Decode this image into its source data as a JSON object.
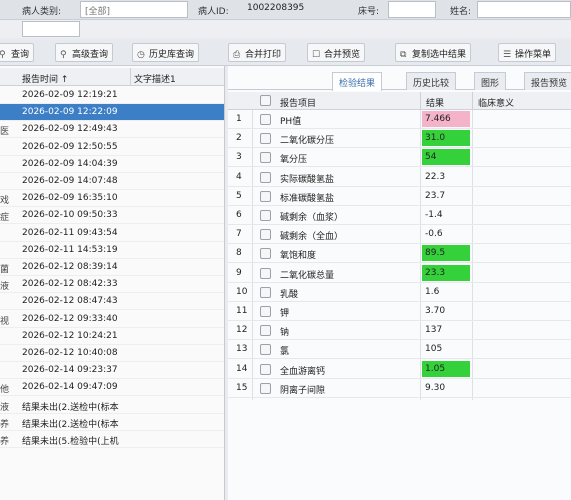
{
  "colors": {
    "selected_row": "#3d7fc6",
    "result_high": "#f4b3c8",
    "result_abnormal": "#35d13a",
    "active_tab_text": "#3a6fb0"
  },
  "topbar": {
    "patient_type_label": "病人类别:",
    "patient_type_value": "[全部]",
    "patient_id_label": "病人ID:",
    "patient_id_value": "1002208395",
    "bed_label": "床号:",
    "name_label": "姓名:"
  },
  "toolbar": {
    "buttons": [
      {
        "label": "查询",
        "icon": "search-icon"
      },
      {
        "label": "高级查询",
        "icon": "search-icon"
      },
      {
        "label": "历史库查询",
        "icon": "history-icon"
      },
      {
        "label": "合并打印",
        "icon": "print-icon"
      },
      {
        "label": "合并预览",
        "icon": "preview-icon"
      },
      {
        "label": "复制选中结果",
        "icon": "copy-icon"
      },
      {
        "label": "操作菜单",
        "icon": "menu-icon"
      }
    ]
  },
  "left_list": {
    "col_time": "报告时间 ↑",
    "col_desc": "文字描述1",
    "rows": [
      {
        "prefix": "",
        "time": "2026-02-09 12:19:21",
        "desc": ""
      },
      {
        "prefix": "",
        "time": "2026-02-09 12:22:09",
        "desc": "",
        "selected": true
      },
      {
        "prefix": "医",
        "time": "2026-02-09 12:49:43",
        "desc": ""
      },
      {
        "prefix": "",
        "time": "2026-02-09 12:50:55",
        "desc": ""
      },
      {
        "prefix": "",
        "time": "2026-02-09 14:04:39",
        "desc": ""
      },
      {
        "prefix": "",
        "time": "2026-02-09 14:07:48",
        "desc": ""
      },
      {
        "prefix": "戏",
        "time": "2026-02-09 16:35:10",
        "desc": ""
      },
      {
        "prefix": "症",
        "time": "2026-02-10 09:50:33",
        "desc": ""
      },
      {
        "prefix": "",
        "time": "2026-02-11 09:43:54",
        "desc": ""
      },
      {
        "prefix": "",
        "time": "2026-02-11 14:53:19",
        "desc": ""
      },
      {
        "prefix": "菌",
        "time": "2026-02-12 08:39:14",
        "desc": ""
      },
      {
        "prefix": "液",
        "time": "2026-02-12 08:42:33",
        "desc": ""
      },
      {
        "prefix": "",
        "time": "2026-02-12 08:47:43",
        "desc": ""
      },
      {
        "prefix": "视",
        "time": "2026-02-12 09:33:40",
        "desc": ""
      },
      {
        "prefix": "",
        "time": "2026-02-12 10:24:21",
        "desc": ""
      },
      {
        "prefix": "",
        "time": "2026-02-12 10:40:08",
        "desc": ""
      },
      {
        "prefix": "",
        "time": "2026-02-14 09:23:37",
        "desc": ""
      },
      {
        "prefix": "他",
        "time": "2026-02-14 09:47:09",
        "desc": ""
      },
      {
        "prefix": "液",
        "time": "结果未出(2.送检中(标本",
        "desc": ""
      },
      {
        "prefix": "养",
        "time": "结果未出(2.送检中(标本",
        "desc": ""
      },
      {
        "prefix": "养",
        "time": "结果未出(5.检验中(上机",
        "desc": ""
      }
    ]
  },
  "tabs": [
    "检验结果",
    "历史比较",
    "图形",
    "报告预览"
  ],
  "results": {
    "col_item": "报告项目",
    "col_result": "结果",
    "col_clinical": "临床意义",
    "rows": [
      {
        "no": "1",
        "item": "PH值",
        "result": "7.466",
        "flag": "pink"
      },
      {
        "no": "2",
        "item": "二氧化碳分压",
        "result": "31.0",
        "flag": "green"
      },
      {
        "no": "3",
        "item": "氧分压",
        "result": "54",
        "flag": "green"
      },
      {
        "no": "4",
        "item": "实际碳酸氢盐",
        "result": "22.3",
        "flag": ""
      },
      {
        "no": "5",
        "item": "标准碳酸氢盐",
        "result": "23.7",
        "flag": ""
      },
      {
        "no": "6",
        "item": "碱剩余（血浆）",
        "result": "-1.4",
        "flag": ""
      },
      {
        "no": "7",
        "item": "碱剩余（全血）",
        "result": "-0.6",
        "flag": ""
      },
      {
        "no": "8",
        "item": "氧饱和度",
        "result": "89.5",
        "flag": "green"
      },
      {
        "no": "9",
        "item": "二氧化碳总量",
        "result": "23.3",
        "flag": "green"
      },
      {
        "no": "10",
        "item": "乳酸",
        "result": "1.6",
        "flag": ""
      },
      {
        "no": "11",
        "item": "钾",
        "result": "3.70",
        "flag": ""
      },
      {
        "no": "12",
        "item": "钠",
        "result": "137",
        "flag": ""
      },
      {
        "no": "13",
        "item": "氯",
        "result": "105",
        "flag": ""
      },
      {
        "no": "14",
        "item": "全血游离钙",
        "result": "1.05",
        "flag": "green"
      },
      {
        "no": "15",
        "item": "阴离子间隙",
        "result": "9.30",
        "flag": ""
      }
    ]
  }
}
